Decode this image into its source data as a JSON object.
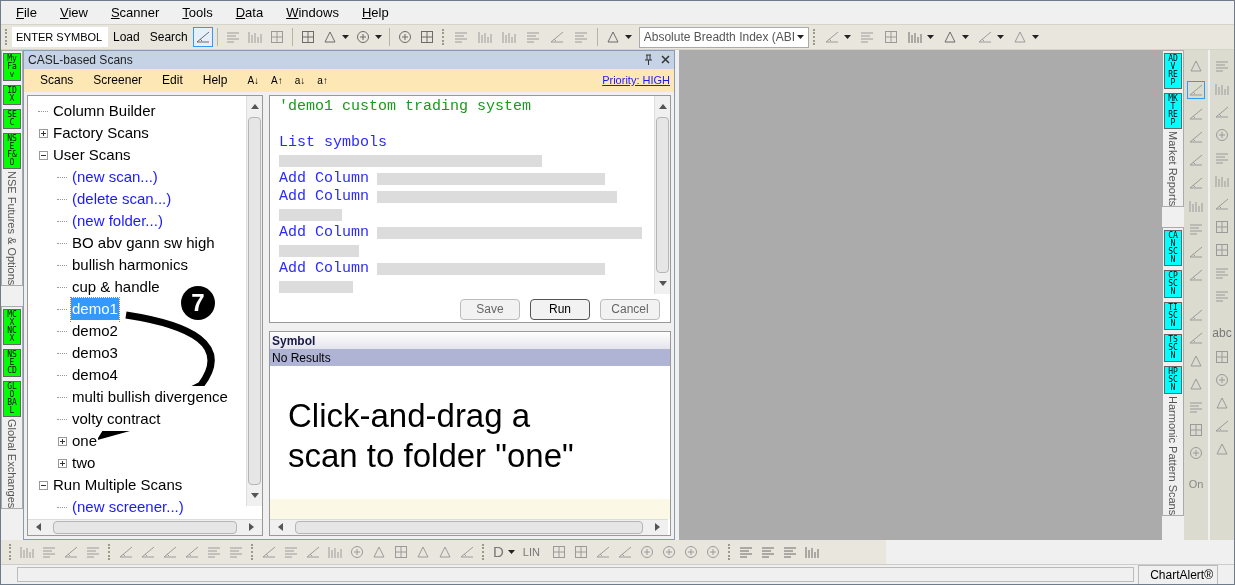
{
  "menu_bar": [
    {
      "label": "File"
    },
    {
      "label": "View"
    },
    {
      "label": "Scanner"
    },
    {
      "label": "Tools"
    },
    {
      "label": "Data"
    },
    {
      "label": "Windows"
    },
    {
      "label": "Help"
    }
  ],
  "toolbar": {
    "symbol_field": {
      "value": "ENTER SYMBOL"
    },
    "buttons": [
      "Load",
      "Search"
    ],
    "indicator_select": {
      "value": "Absolute Breadth Index (ABI"
    }
  },
  "left_strip": [
    {
      "badges": [
        "My Fav",
        "IDX",
        "SEC",
        "NSE F&O"
      ],
      "label": "NSE Futures & Options"
    },
    {
      "badges": [
        "MCX NCX",
        "NSE CD",
        "GLO BAL"
      ],
      "label": "Global Exchanges"
    }
  ],
  "panel": {
    "title": "CASL-based Scans",
    "menu": [
      "Scans",
      "Screener",
      "Edit",
      "Help"
    ],
    "font_buttons": [
      "A↓",
      "A↑",
      "a↓",
      "a↑"
    ],
    "priority": "Priority: HIGH"
  },
  "tree": [
    {
      "label": "Column Builder",
      "kind": "item",
      "selected": false
    },
    {
      "label": "Factory Scans",
      "kind": "folder",
      "expanded": false,
      "selected": false
    },
    {
      "label": "User Scans",
      "kind": "folder",
      "expanded": true,
      "selected": false,
      "children": [
        {
          "label": "(new scan...)",
          "kind": "action",
          "selected": false
        },
        {
          "label": "(delete scan...)",
          "kind": "action",
          "selected": false
        },
        {
          "label": "(new folder...)",
          "kind": "action",
          "selected": false
        },
        {
          "label": "BO abv gann sw high",
          "kind": "item",
          "selected": false
        },
        {
          "label": "bullish harmonics",
          "kind": "item",
          "selected": false
        },
        {
          "label": "cup & handle",
          "kind": "item",
          "selected": false
        },
        {
          "label": "demo1",
          "kind": "item",
          "selected": true
        },
        {
          "label": "demo2",
          "kind": "item",
          "selected": false
        },
        {
          "label": "demo3",
          "kind": "item",
          "selected": false
        },
        {
          "label": "demo4",
          "kind": "item",
          "selected": false
        },
        {
          "label": "multi bullish divergence",
          "kind": "item",
          "selected": false
        },
        {
          "label": "volty contract",
          "kind": "item",
          "selected": false
        },
        {
          "label": "one",
          "kind": "folder",
          "expanded": false,
          "selected": false
        },
        {
          "label": "two",
          "kind": "folder",
          "expanded": false,
          "selected": false
        }
      ]
    },
    {
      "label": "Run Multiple Scans",
      "kind": "folder",
      "expanded": true,
      "selected": false,
      "children": [
        {
          "label": "(new screener...)",
          "kind": "action",
          "selected": false
        }
      ]
    }
  ],
  "editor": {
    "lines": [
      {
        "kind": "comment",
        "text": "'demo1 custom trading system"
      },
      {
        "kind": "blank"
      },
      {
        "kind": "code",
        "text": "List symbols"
      },
      {
        "kind": "redacted"
      },
      {
        "kind": "code",
        "text": "Add Column",
        "redacted": true
      },
      {
        "kind": "code",
        "text": "Add Column",
        "redacted": true
      },
      {
        "kind": "redacted"
      },
      {
        "kind": "code",
        "text": "Add Column",
        "redacted": true
      },
      {
        "kind": "redacted"
      },
      {
        "kind": "code",
        "text": "Add Column",
        "redacted": true
      },
      {
        "kind": "redacted"
      }
    ],
    "buttons": [
      {
        "label": "Save",
        "default": false
      },
      {
        "label": "Run",
        "default": true
      },
      {
        "label": "Cancel",
        "default": false
      }
    ]
  },
  "results": {
    "column": "Symbol",
    "message": "No Results"
  },
  "annotation": {
    "step": "7",
    "lines": [
      "Click-and-drag a",
      "scan to folder \"one\""
    ]
  },
  "right_strip": [
    {
      "badges": [
        "ADV REP",
        "MKT REP"
      ],
      "label": "Market Reports"
    },
    {
      "badges": [
        "CAN SCN",
        "CP SCN",
        "TI SCN",
        "TS SCN",
        "HP SCN"
      ],
      "label": "Harmonic Pattern Scans"
    }
  ],
  "drawing_tools": {
    "shape_label": "abc",
    "toggle_label": "On"
  },
  "bottom_toolbar": {
    "chart_type": "D",
    "scale_label": "LIN"
  },
  "status_bar": {
    "brand": "ChartAlert®"
  }
}
